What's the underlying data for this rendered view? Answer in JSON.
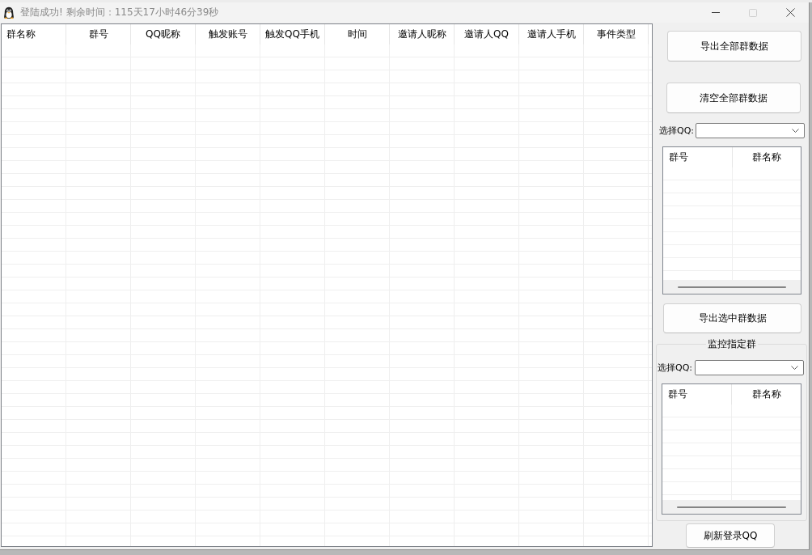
{
  "window": {
    "title": "登陆成功! 剩余时间：115天17小时46分39秒",
    "controls": [
      {
        "kind": "minimize",
        "disabled": false
      },
      {
        "kind": "maximize",
        "disabled": true
      },
      {
        "kind": "close",
        "disabled": false
      }
    ]
  },
  "table": {
    "columns": [
      "群名称",
      "群号",
      "QQ昵称",
      "触发账号",
      "触发QQ手机",
      "时间",
      "邀请人昵称",
      "邀请人QQ",
      "邀请人手机",
      "事件类型"
    ]
  },
  "side_panel": {
    "export_all_button": "导出全部群数据",
    "clear_all_button": "清空全部群数据",
    "qq_select": {
      "label": "选择QQ:"
    },
    "group_list": {
      "columns": [
        "群号",
        "群名称"
      ]
    },
    "export_selected_button": "导出选中群数据",
    "monitor_group": {
      "title": "监控指定群",
      "qq_select": {
        "label": "选择QQ:"
      },
      "group_list": {
        "columns": [
          "群号",
          "群名称"
        ]
      }
    },
    "refresh_login_button": "刷新登录QQ"
  }
}
